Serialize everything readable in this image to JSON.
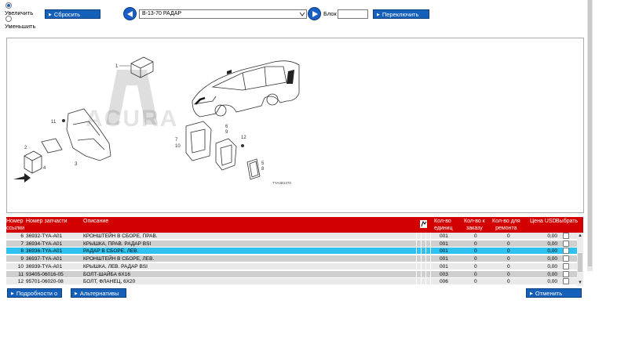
{
  "toolbar": {
    "zoom_in_label": "Увеличить",
    "zoom_out_label": "Уменьшить",
    "reset_label": "Сбросить",
    "section_select_value": "B-13-70 РАДАР",
    "block_label": "Блок",
    "block_value": "",
    "switch_label": "Переключить"
  },
  "diagram": {
    "brand_watermark": "ACURA",
    "ref_code": "TYA4B1370",
    "callouts": [
      "1",
      "2",
      "3",
      "4",
      "5",
      "6",
      "7",
      "8",
      "9",
      "10",
      "11",
      "12"
    ]
  },
  "table": {
    "headers": {
      "ref": [
        "Номер",
        "ссылки"
      ],
      "part": "Номер запчасти",
      "desc": "Описание",
      "units": [
        "Кол-во",
        "единиц"
      ],
      "order": [
        "Кол-во к",
        "заказу"
      ],
      "repair": [
        "Кол-во для",
        "ремонта"
      ],
      "price": "Цена USD",
      "select": "Выбрать"
    },
    "rows": [
      {
        "ref": "6",
        "part": "36932-TYA-A01",
        "desc": "КРОНШТЕЙН В СБОРЕ, ПРАВ.",
        "units": "001",
        "order": "0",
        "repair": "0",
        "price": "0,00"
      },
      {
        "ref": "7",
        "part": "36934-TYA-A01",
        "desc": "КРЫШКА, ПРАВ. РАДАР BSI",
        "units": "001",
        "order": "0",
        "repair": "0",
        "price": "0,00"
      },
      {
        "ref": "8",
        "part": "36936-TYA-A01",
        "desc": "РАДАР В СБОРЕ, ЛЕВ.",
        "units": "001",
        "order": "0",
        "repair": "0",
        "price": "0,00"
      },
      {
        "ref": "9",
        "part": "36937-TYA-A01",
        "desc": "КРОНШТЕЙН В СБОРЕ, ЛЕВ.",
        "units": "001",
        "order": "0",
        "repair": "0",
        "price": "0,00"
      },
      {
        "ref": "10",
        "part": "36939-TYA-A01",
        "desc": "КРЫШКА, ЛЕВ. РАДАР BSI",
        "units": "001",
        "order": "0",
        "repair": "0",
        "price": "0,00"
      },
      {
        "ref": "11",
        "part": "93405-06016-05",
        "desc": "БОЛТ-ШАЙБА 6X16",
        "units": "003",
        "order": "0",
        "repair": "0",
        "price": "0,00"
      },
      {
        "ref": "12",
        "part": "95701-06020-08",
        "desc": "БОЛТ, ФЛАНЕЦ, 6X20",
        "units": "006",
        "order": "0",
        "repair": "0",
        "price": "0,00"
      }
    ],
    "selected_row_index": 2
  },
  "footer": {
    "details_label": "Подробности о",
    "alternatives_label": "Альтернативы",
    "cancel_label": "Отменить"
  },
  "colors": {
    "accent_blue": "#1560b8",
    "header_red": "#d30000",
    "selected_row": "#2dc2ef"
  }
}
